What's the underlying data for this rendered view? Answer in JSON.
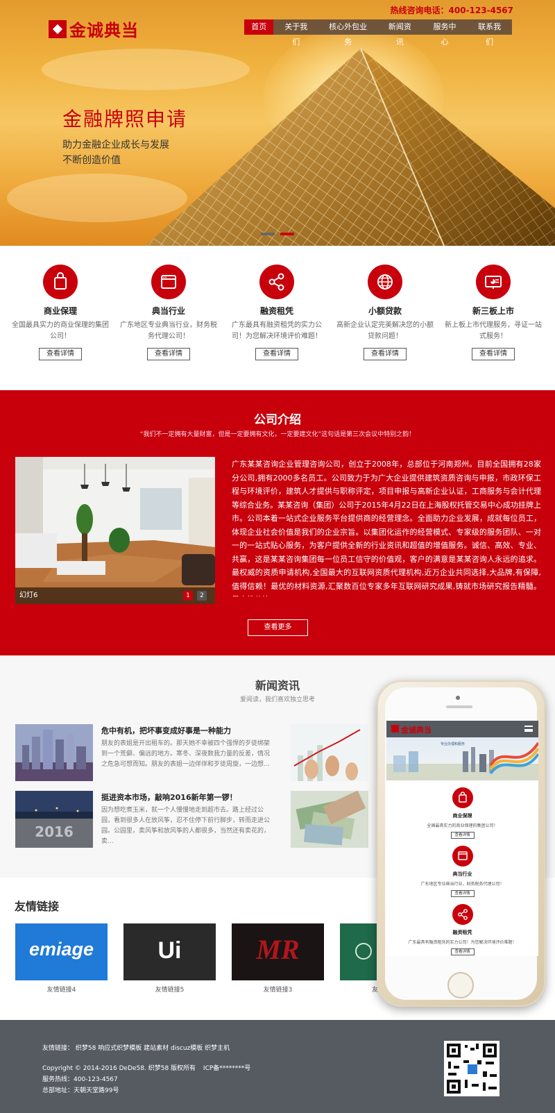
{
  "header": {
    "logo_text": "金诚典当",
    "hotline": "热线咨询电话：400-123-4567",
    "nav": [
      "首页",
      "关于我们",
      "核心外包业务",
      "新闻资讯",
      "服务中心",
      "联系我们"
    ]
  },
  "hero": {
    "title": "金融牌照申请",
    "line1": "助力金融企业成长与发展",
    "line2": "不断创造价值",
    "slide_count": 2,
    "active_slide": 2
  },
  "services": [
    {
      "name": "商业保理",
      "desc": "全国最具实力的商业保理的集团公司！",
      "button": "查看详情",
      "icon": "shopping-bag-icon"
    },
    {
      "name": "典当行业",
      "desc": "广东地区专业典当行业，财务税务代理公司！",
      "button": "查看详情",
      "icon": "browser-window-icon"
    },
    {
      "name": "融资租凭",
      "desc": "广东最具有融资租凭的实力公司！为您解决环境评价难题！",
      "button": "查看详情",
      "icon": "share-icon"
    },
    {
      "name": "小额贷款",
      "desc": "高新企业认定完美解决您的小额贷款问题！",
      "button": "查看详情",
      "icon": "globe-icon"
    },
    {
      "name": "新三板上市",
      "desc": "新上板上市代理服务，寻证一站式服务！",
      "button": "查看详情",
      "icon": "presentation-icon"
    }
  ],
  "about": {
    "title": "公司介绍",
    "subtitle": "“我们不一定拥有大量财富，但是一定要拥有文化，一定要建文化”这句话是第三次会议中特别之韵！",
    "text": "广东某某咨询企业管理咨询公司，创立于2008年，总部位于河南郑州。目前全国拥有28家分公司,拥有2000多名员工。公司致力于为广大企业提供建筑资质咨询与申报，市政环保工程与环境评价，建筑人才提供与职称评定，项目申报与高新企业认证，工商服务与会计代理等综合业务。某某咨询（集团）公司于2015年4月22日在上海股权托管交易中心成功挂牌上市。公司本着一站式企业服务平台提供商的经营理念。全面助力企业发展，成就每位员工，体现企业社会价值是我们的企业宗旨。以集团化运作的经营模式、专家级的服务团队、一对一的一站式贴心服务，为客户提供全新的行业资讯和超值的增值服务。诚信、高效、专业、共赢，这是某某咨询集团每一位员工信守的价值观，客户的满意是某某咨询人永远的追求。最权威的资质申请机构,全国最大的互联网资质代理机构,近万企业共同选择,大品牌,有保障,值得信赖！最优的材料资源,汇聚数百位专家多年互联网研究成果,铸就市场研究报告精髓。最高性价比",
    "photo_caption": "幻灯6",
    "pages": [
      "1",
      "2"
    ],
    "more_button": "查看更多"
  },
  "news": {
    "title": "新闻资讯",
    "subtitle": "爱阅读，我们喜欢独立思考",
    "items": [
      {
        "title": "危中有机，把坏事变成好事是一种能力",
        "summary": "朋友的表姐是开出租车的。那天她不幸被四个强悍的歹徒绑架到一个荒僻、偏远的地方。寒冬、深夜数我力量的反差，情况之危急可想而知。朋友的表姐一边佯佯和歹徒周旋，一边想..."
      },
      {
        "title": "挺进资本市场，敲响2016新年第一锣！",
        "summary": "因为想吃煮玉米，就一个人慢慢地走到超市去。路上经过公园，看到很多人在放风筝，忍不住停下前行脚步，转而走进公园。公园里，卖风筝和放风筝的人都很多，当然还有卖花的，卖..."
      }
    ]
  },
  "links": {
    "title": "友情链接",
    "items": [
      "友情链接4",
      "友情链接5",
      "友情链接3",
      "友"
    ],
    "logo_texts": [
      "emiage",
      "Ui",
      "MR"
    ]
  },
  "footer": {
    "links_label": "友情链接：",
    "links": [
      "织梦58",
      "响应式织梦模板",
      "建站素材",
      "discuz模板",
      "织梦主机"
    ],
    "copyright": "Copyright © 2014-2016 DeDe58. 织梦58 版权所有",
    "icp": "ICP备********号",
    "service": "服务热线：400-123-4567",
    "address": "总部地址：天朝天堂路99号"
  },
  "phone_preview": {
    "logo_text": "金诚典当",
    "banner_text": "专业办理和服务",
    "services": [
      {
        "name": "商业保理",
        "desc": "全国最具实力的商业保理的集团公司！",
        "button": "查看详情"
      },
      {
        "name": "典当行业",
        "desc": "广东地区专业典当行业，财务税务代理公司！",
        "button": "查看详情"
      },
      {
        "name": "融资租凭",
        "desc": "广东最具有融资租凭的实力公司！为您解决环境评价难题！",
        "button": "查看详情"
      }
    ]
  },
  "colors": {
    "brand_red": "#c8000c",
    "footer_gray": "#565b62",
    "nav_dark": "#5a463c"
  }
}
